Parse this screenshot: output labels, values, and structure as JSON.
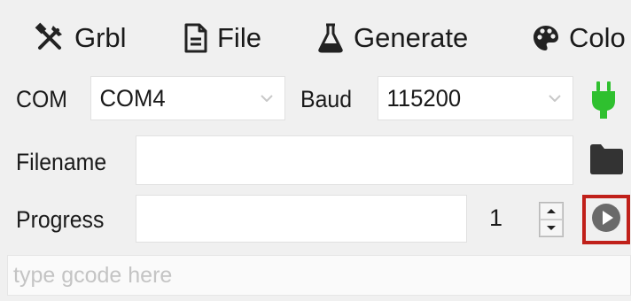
{
  "menu": {
    "grbl_label": "Grbl",
    "file_label": "File",
    "generate_label": "Generate",
    "color_label": "Colo"
  },
  "connection": {
    "com_label": "COM",
    "com_value": "COM4",
    "baud_label": "Baud",
    "baud_value": "115200"
  },
  "file": {
    "filename_label": "Filename",
    "filename_value": ""
  },
  "progress": {
    "label": "Progress",
    "value": "",
    "count_value": "1"
  },
  "gcode": {
    "placeholder": "type gcode here"
  },
  "colors": {
    "plug_green": "#2fc02f",
    "highlight_red": "#c0201a",
    "folder_dark": "#333333"
  },
  "icons": {
    "grbl": "tools-icon",
    "file": "file-icon",
    "generate": "flask-icon",
    "color": "palette-icon",
    "connect": "plug-icon",
    "open": "folder-icon",
    "run": "play-icon"
  }
}
